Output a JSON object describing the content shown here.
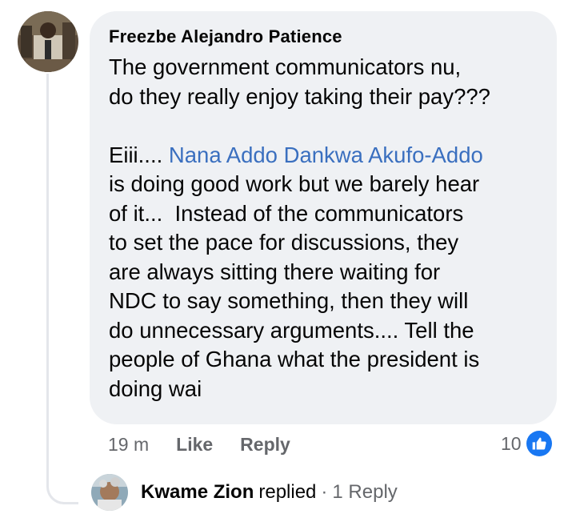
{
  "comment": {
    "author": "Freezbe Alejandro Patience",
    "paragraph1": "The government communicators nu,\ndo they really enjoy taking their pay???",
    "paragraph2_prefix": "Eiii.... ",
    "mention": "Nana Addo Dankwa Akufo-Addo",
    "paragraph2_rest": "\nis doing good work but we barely hear\nof it...  Instead of the communicators\nto set the pace for discussions, they\nare always sitting there waiting for\nNDC to say something, then they will\ndo unnecessary arguments.... Tell the\npeople of Ghana what the president is\ndoing wai",
    "time": "19 m",
    "like_label": "Like",
    "reply_label": "Reply",
    "reaction_count": "10",
    "reaction_icon": "like-thumb-icon",
    "accent_color": "#1877f2"
  },
  "reply_summary": {
    "name": "Kwame Zion",
    "verb": "replied",
    "separator": "·",
    "count_label": "1 Reply"
  }
}
